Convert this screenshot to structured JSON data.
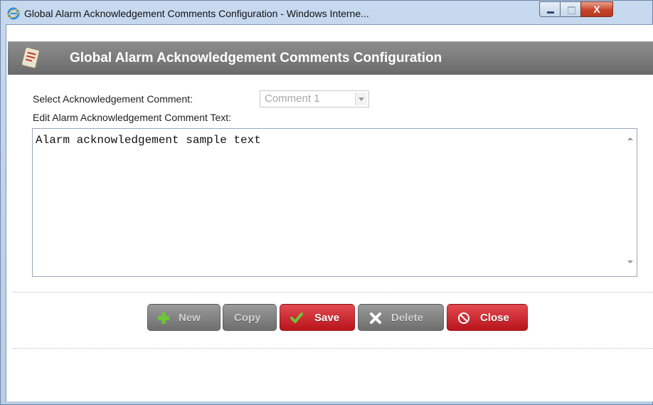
{
  "window": {
    "title": "Global Alarm Acknowledgement Comments Configuration - Windows Interne...",
    "controls": {
      "minimize": "minimize",
      "maximize": "maximize",
      "close": "X"
    }
  },
  "header": {
    "title": "Global Alarm Acknowledgement Comments Configuration",
    "icon": "notepad-icon"
  },
  "form": {
    "select_label": "Select Acknowledgement Comment:",
    "select_value": "Comment 1",
    "edit_label": "Edit Alarm Acknowledgement Comment Text:",
    "comment_text": "Alarm acknowledgement sample text"
  },
  "buttons": {
    "new": "New",
    "copy": "Copy",
    "save": "Save",
    "delete": "Delete",
    "close": "Close"
  },
  "colors": {
    "header_gray": "#7a7a7a",
    "button_red": "#c7232a",
    "button_gray": "#838383",
    "plus_green": "#6cc43a"
  }
}
